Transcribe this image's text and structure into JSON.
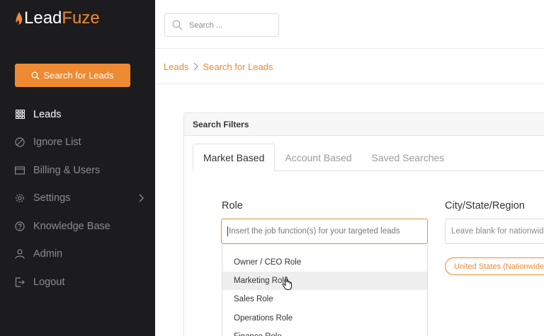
{
  "brand": {
    "prefix": "Lead",
    "accent": "Fuze",
    "accent_color": "#ee8a32",
    "icon": "flame-icon"
  },
  "sidebar": {
    "search_button": {
      "label": "Search for Leads",
      "icon": "search-icon"
    },
    "items": [
      {
        "label": "Leads",
        "icon": "grid-icon",
        "active": true
      },
      {
        "label": "Ignore List",
        "icon": "block-icon"
      },
      {
        "label": "Billing & Users",
        "icon": "card-icon"
      },
      {
        "label": "Settings",
        "icon": "gear-icon",
        "has_submenu": true
      },
      {
        "label": "Knowledge Base",
        "icon": "help-icon"
      },
      {
        "label": "Admin",
        "icon": "user-icon"
      },
      {
        "label": "Logout",
        "icon": "logout-icon"
      }
    ]
  },
  "topbar": {
    "search_placeholder": "Search ..."
  },
  "breadcrumb": {
    "items": [
      "Leads",
      "Search for Leads"
    ]
  },
  "panel": {
    "title": "Search Filters",
    "tabs": [
      "Market Based",
      "Account Based",
      "Saved Searches"
    ],
    "active_tab": "Market Based"
  },
  "filters": {
    "role": {
      "label": "Role",
      "placeholder": "Insert the job function(s) for your targeted leads",
      "options": [
        "Owner / CEO Role",
        "Marketing Role",
        "Sales Role",
        "Operations Role",
        "Finance Role"
      ],
      "hovered_option": "Marketing Role"
    },
    "location": {
      "label": "City/State/Region",
      "placeholder": "Leave blank for nationwide",
      "selected_tag": "United States (Nationwide)"
    }
  }
}
